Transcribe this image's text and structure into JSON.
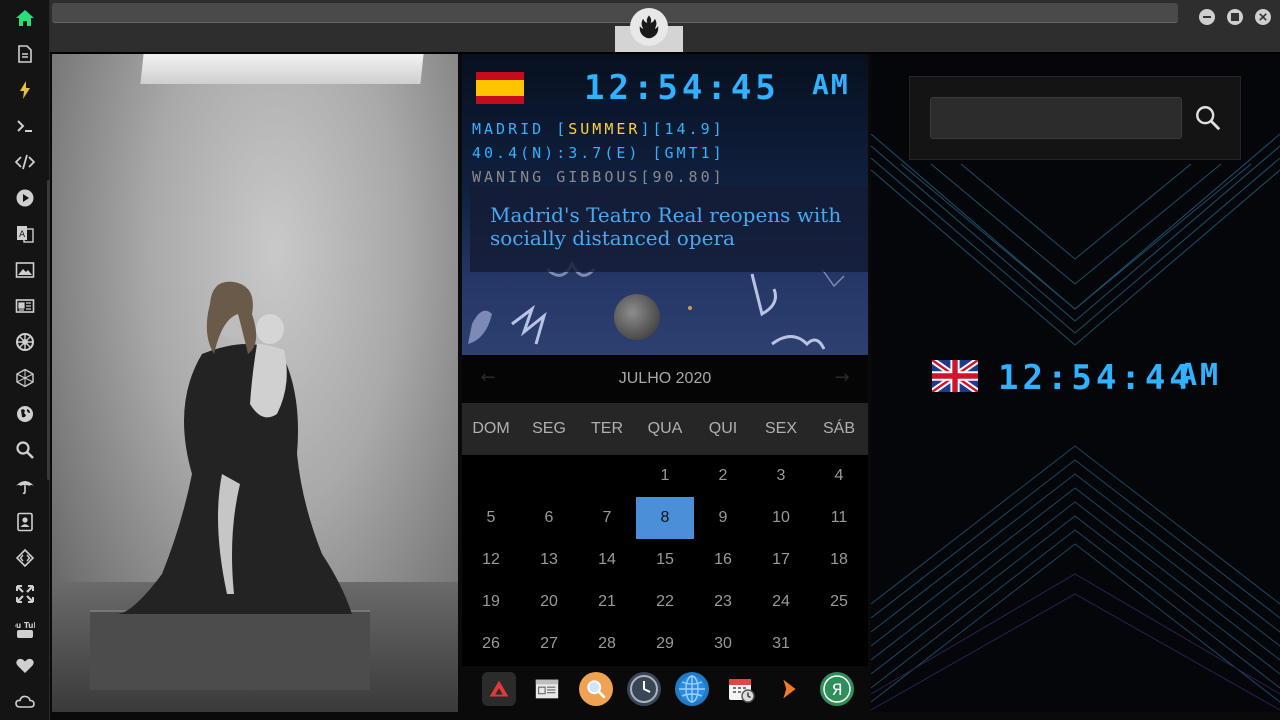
{
  "sidebar": {
    "items": [
      {
        "name": "home-icon"
      },
      {
        "name": "document-icon"
      },
      {
        "name": "lightning-icon"
      },
      {
        "name": "terminal-icon"
      },
      {
        "name": "code-icon"
      },
      {
        "name": "play-icon"
      },
      {
        "name": "translate-icon"
      },
      {
        "name": "image-icon"
      },
      {
        "name": "news-icon"
      },
      {
        "name": "empire-icon"
      },
      {
        "name": "hexagon-icon"
      },
      {
        "name": "globe-icon"
      },
      {
        "name": "search-icon"
      },
      {
        "name": "umbrella-icon"
      },
      {
        "name": "contacts-icon"
      },
      {
        "name": "code-diamond-icon"
      },
      {
        "name": "expand-icon"
      },
      {
        "name": "youtube-icon"
      },
      {
        "name": "heart-icon"
      },
      {
        "name": "cloud-icon"
      }
    ],
    "youtube_label": "You Tube"
  },
  "colors": {
    "accent_green": "#27e07a",
    "lcd_blue": "#2fb2ff",
    "today_blue": "#4a90d9"
  },
  "madrid": {
    "time": "12:54:45",
    "ampm": "AM",
    "line1_prefix": "MADRID [",
    "line1_season": "SUMMER",
    "line1_suffix": "][14.9]",
    "line2": "40.4(N):3.7(E) [GMT1]",
    "line3": "WANING GIBBOUS[90.80]",
    "news": "Madrid's Teatro Real reopens with socially distanced opera"
  },
  "calendar": {
    "title": "JULHO 2020",
    "days": [
      "DOM",
      "SEG",
      "TER",
      "QUA",
      "QUI",
      "SEX",
      "SÁB"
    ],
    "first_weekday": 3,
    "days_in_month": 31,
    "today": 8
  },
  "dock": {
    "apps": [
      "app-launcher-icon",
      "calendar-newspaper-icon",
      "search-app-icon",
      "clock-app-icon",
      "globe-app-icon",
      "calendar-clock-icon",
      "arrow-app-icon",
      "yandex-icon"
    ]
  },
  "london": {
    "time": "12:54:44",
    "ampm": "AM"
  },
  "search": {
    "value": ""
  }
}
